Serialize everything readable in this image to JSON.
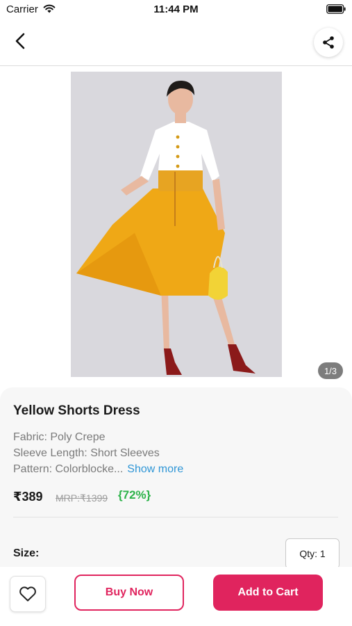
{
  "status_bar": {
    "carrier": "Carrier",
    "time": "11:44 PM",
    "icons": [
      "wifi-icon",
      "battery-icon"
    ]
  },
  "nav": {
    "back_icon": "chevron-left-icon",
    "share_icon": "share-icon"
  },
  "gallery": {
    "image": "yellow-dress-model-photo",
    "counter": "1/3"
  },
  "product": {
    "title": "Yellow Shorts Dress",
    "attributes": {
      "fabric": "Fabric: Poly Crepe",
      "sleeve": "Sleeve Length: Short Sleeves",
      "pattern": "Pattern: Colorblocke..."
    },
    "show_more": "Show more",
    "price": "₹389",
    "mrp": "MRP:₹1399",
    "discount": "{72%}",
    "size_label": "Size:",
    "qty": "Qty: 1"
  },
  "actions": {
    "wishlist_icon": "heart-icon",
    "buy_now": "Buy Now",
    "add_to_cart": "Add to Cart"
  },
  "colors": {
    "accent": "#e0245e",
    "discount": "#2db34a",
    "link": "#2f96d6"
  }
}
